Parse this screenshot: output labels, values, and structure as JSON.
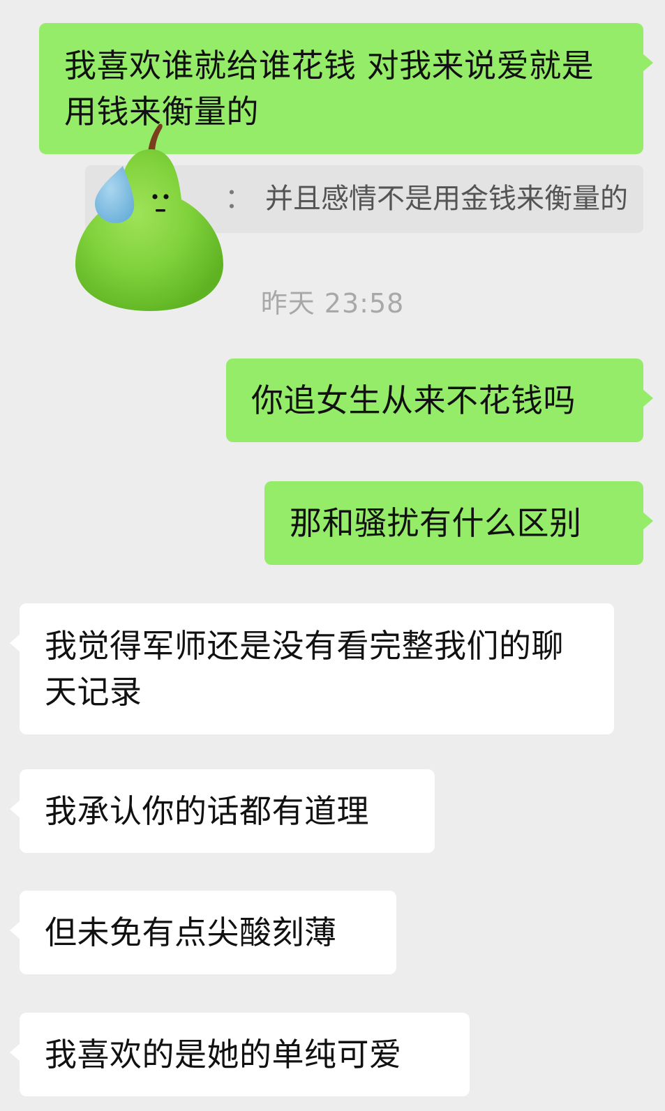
{
  "colors": {
    "background": "#ededed",
    "outgoing_bubble": "#95ec69",
    "incoming_bubble": "#ffffff",
    "quote_background": "#e3e3e3",
    "timestamp_text": "#a8a8a8"
  },
  "messages": [
    {
      "direction": "outgoing",
      "text": "我喜欢谁就给谁花钱 对我来说爱就是用钱来衡量的"
    },
    {
      "direction": "outgoing",
      "text": "你追女生从来不花钱吗"
    },
    {
      "direction": "outgoing",
      "text": "那和骚扰有什么区别"
    },
    {
      "direction": "incoming",
      "text": "我觉得军师还是没有看完整我们的聊天记录"
    },
    {
      "direction": "incoming",
      "text": "我承认你的话都有道理"
    },
    {
      "direction": "incoming",
      "text": "但未免有点尖酸刻薄"
    },
    {
      "direction": "incoming",
      "text": "我喜欢的是她的单纯可爱"
    }
  ],
  "quote": {
    "separator": "：",
    "text": "并且感情不是用金钱来衡量的"
  },
  "timestamp": "昨天 23:58",
  "sticker": {
    "icon": "sweating-pear-sticker-icon"
  }
}
